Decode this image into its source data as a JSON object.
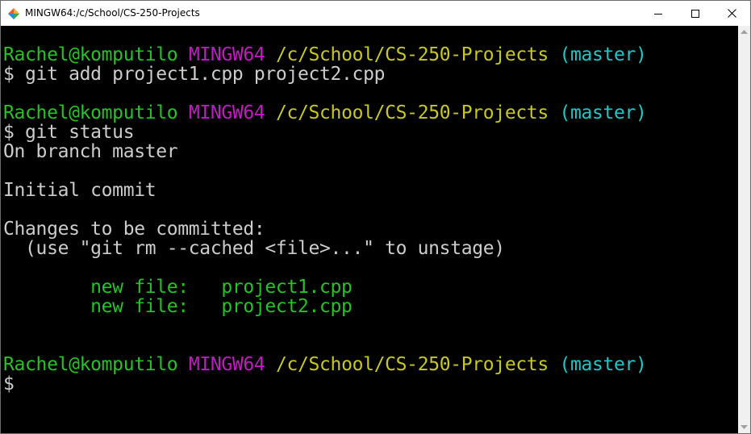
{
  "window": {
    "title": "MINGW64:/c/School/CS-250-Projects"
  },
  "colors": {
    "user": "#23c423",
    "msystem": "#c419c4",
    "path": "#c8c81e",
    "branch": "#1ec8c8",
    "text": "#cccccc",
    "added": "#23c423",
    "background": "#000000"
  },
  "terminal": {
    "lines": [
      [
        {
          "text": "Rachel@komputilo",
          "color": "user"
        },
        {
          "text": " "
        },
        {
          "text": "MINGW64",
          "color": "msystem"
        },
        {
          "text": " "
        },
        {
          "text": "/c/School/CS-250-Projects",
          "color": "path"
        },
        {
          "text": " "
        },
        {
          "text": "(master)",
          "color": "branch"
        }
      ],
      [
        {
          "text": "$ git add project1.cpp project2.cpp",
          "color": "text"
        }
      ],
      [],
      [
        {
          "text": "Rachel@komputilo",
          "color": "user"
        },
        {
          "text": " "
        },
        {
          "text": "MINGW64",
          "color": "msystem"
        },
        {
          "text": " "
        },
        {
          "text": "/c/School/CS-250-Projects",
          "color": "path"
        },
        {
          "text": " "
        },
        {
          "text": "(master)",
          "color": "branch"
        }
      ],
      [
        {
          "text": "$ git status",
          "color": "text"
        }
      ],
      [
        {
          "text": "On branch master",
          "color": "text"
        }
      ],
      [],
      [
        {
          "text": "Initial commit",
          "color": "text"
        }
      ],
      [],
      [
        {
          "text": "Changes to be committed:",
          "color": "text"
        }
      ],
      [
        {
          "text": "  (use \"git rm --cached <file>...\" to unstage)",
          "color": "text"
        }
      ],
      [],
      [
        {
          "text": "        new file:   project1.cpp",
          "color": "added"
        }
      ],
      [
        {
          "text": "        new file:   project2.cpp",
          "color": "added"
        }
      ],
      [],
      [],
      [
        {
          "text": "Rachel@komputilo",
          "color": "user"
        },
        {
          "text": " "
        },
        {
          "text": "MINGW64",
          "color": "msystem"
        },
        {
          "text": " "
        },
        {
          "text": "/c/School/CS-250-Projects",
          "color": "path"
        },
        {
          "text": " "
        },
        {
          "text": "(master)",
          "color": "branch"
        }
      ],
      [
        {
          "text": "$",
          "color": "text"
        }
      ]
    ]
  }
}
